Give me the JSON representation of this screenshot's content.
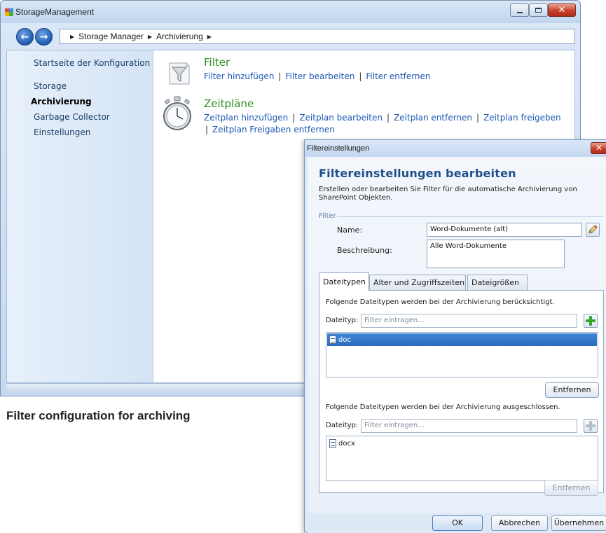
{
  "main_window": {
    "title": "StorageManagement",
    "close_glyph": "✕",
    "nav": {
      "back_glyph": "←",
      "forward_glyph": "→"
    },
    "breadcrumb": [
      "Storage Manager",
      "Archivierung"
    ],
    "sidebar": {
      "items": [
        {
          "label": "Startseite der Konfiguration",
          "active": false
        },
        {
          "label": "Storage",
          "active": false
        },
        {
          "label": "Archivierung",
          "active": true
        },
        {
          "label": "Garbage Collector",
          "active": false
        },
        {
          "label": "Einstellungen",
          "active": false
        }
      ]
    },
    "filter_section": {
      "title": "Filter",
      "icon": "funnel-icon",
      "links": [
        "Filter hinzufügen",
        "Filter bearbeiten",
        "Filter entfernen"
      ]
    },
    "schedule_section": {
      "title": "Zeitpläne",
      "icon": "stopwatch-icon",
      "links_line1": [
        "Zeitplan hinzufügen",
        "Zeitplan bearbeiten",
        "Zeitplan entfernen",
        "Zeitplan freigeben"
      ],
      "links_line2": [
        "Zeitplan Freigaben entfernen"
      ]
    }
  },
  "caption": "Filter configuration for archiving",
  "dialog": {
    "title": "Filtereinstellungen",
    "close_glyph": "✕",
    "heading": "Filtereinstellungen bearbeiten",
    "description": "Erstellen oder bearbeiten Sie Filter für die automatische Archivierung von SharePoint Objekten.",
    "group_label": "Filter",
    "name_label": "Name:",
    "name_value": "Word-Dokumente (alt)",
    "description_label": "Beschreibung:",
    "description_value": "Alle Word-Dokumente",
    "tabs": [
      "Dateitypen",
      "Alter und Zugriffszeiten",
      "Dateigrößen"
    ],
    "active_tab": "Dateitypen",
    "include": {
      "text": "Folgende Dateitypen werden bei der Archivierung berücksichtigt.",
      "field_label": "Dateityp:",
      "placeholder": "Filter eintragen...",
      "items": [
        "doc"
      ],
      "selected": "doc",
      "remove_label": "Entfernen",
      "remove_enabled": true
    },
    "exclude": {
      "text": "Folgende Dateitypen werden bei der Archivierung ausgeschlossen.",
      "field_label": "Dateityp:",
      "placeholder": "Filter eintragen...",
      "items": [
        "docx"
      ],
      "remove_label": "Entfernen",
      "remove_enabled": false
    },
    "buttons": {
      "ok": "OK",
      "cancel": "Abbrechen",
      "apply": "Übernehmen"
    }
  },
  "colors": {
    "link": "#1a58b3",
    "section_title": "#2b8f1e",
    "heading": "#1f4f8a",
    "selection": "#2a6cbf",
    "add_enabled": "#3aa52a"
  }
}
